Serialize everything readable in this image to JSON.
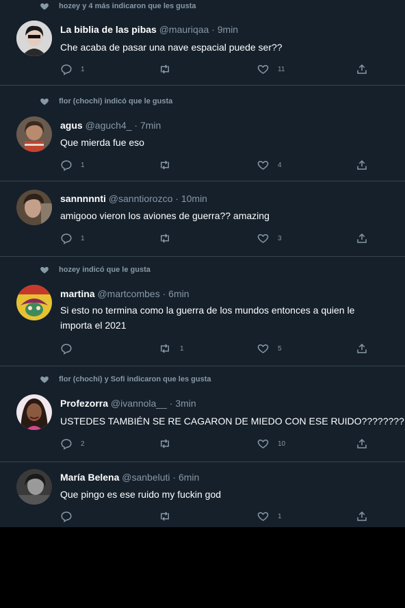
{
  "tweets": [
    {
      "social": "hozey y 4 más indicaron que les gusta",
      "name": "La biblia de las pibas",
      "handle": "@mauriqaa",
      "time": "9min",
      "text": [
        "Che acaba de pasar una nave espacial puede ser??"
      ],
      "replies": "1",
      "retweets": "",
      "likes": "11"
    },
    {
      "social": "flor (chochi) indicó que le gusta",
      "name": "agus",
      "handle": "@aguch4_",
      "time": "7min",
      "text": [
        "Que mierda fue eso"
      ],
      "replies": "1",
      "retweets": "",
      "likes": "4"
    },
    {
      "social": "",
      "name": "sannnnnti",
      "handle": "@sanntiorozco",
      "time": "10min",
      "text": [
        "amigooo vieron los aviones de guerra?? amazing"
      ],
      "replies": "1",
      "retweets": "",
      "likes": "3"
    },
    {
      "social": "hozey indicó que le gusta",
      "name": "martina",
      "handle": "@martcombes",
      "time": "6min",
      "text": [
        "Si esto no termina como la guerra de los mundos entonces a quien le",
        "importa el 2021"
      ],
      "replies": "",
      "retweets": "1",
      "likes": "5"
    },
    {
      "social": "flor (chochi) y Sofi indicaron que les gusta",
      "name": "Profezorra",
      "handle": "@ivannola__",
      "time": "3min",
      "text": [
        "USTEDES TAMBIÉN SE RE CAGARON DE MIEDO CON ESE RUIDO????????"
      ],
      "replies": "2",
      "retweets": "",
      "likes": "10"
    },
    {
      "social": "",
      "name": "María Belena",
      "handle": "@sanbeluti",
      "time": "6min",
      "text": [
        "Que pingo es ese ruido my fuckin god"
      ],
      "replies": "",
      "retweets": "",
      "likes": "1"
    }
  ],
  "colors": {
    "background": "#15202b",
    "divider": "#38444d",
    "secondary_text": "#8899a6",
    "primary_text": "#ffffff",
    "outer": "#000000"
  },
  "icons": {
    "social": "heart-filled-icon",
    "reply": "reply-icon",
    "retweet": "retweet-icon",
    "like": "heart-outline-icon",
    "share": "share-icon"
  }
}
